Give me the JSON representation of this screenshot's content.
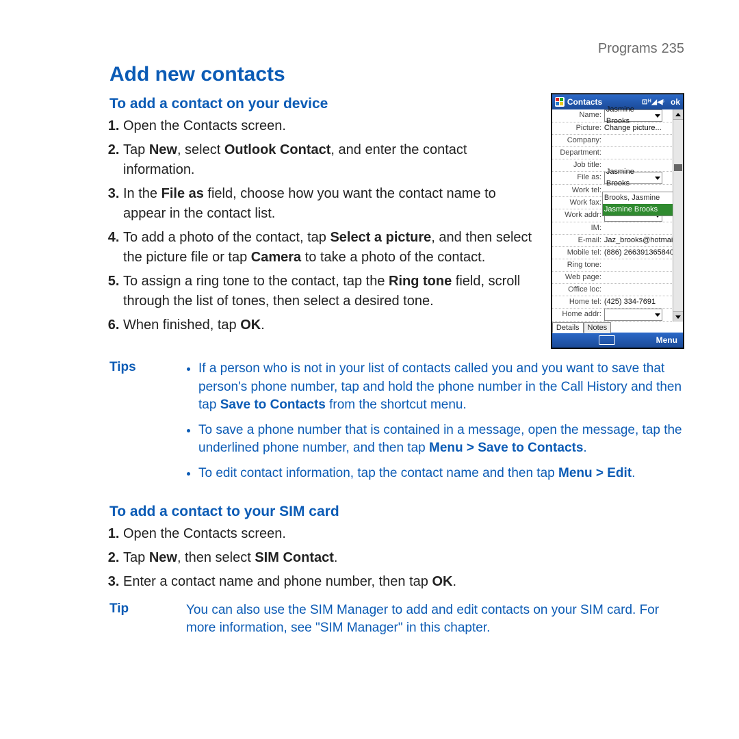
{
  "header": {
    "section": "Programs",
    "page": "235"
  },
  "h1": "Add new contacts",
  "sec1": {
    "title": "To add a contact on your device",
    "steps": {
      "s1": "Open the Contacts screen.",
      "s2a": "Tap ",
      "s2b": "New",
      "s2c": ", select ",
      "s2d": "Outlook Contact",
      "s2e": ", and enter the contact information.",
      "s3a": "In the ",
      "s3b": "File as",
      "s3c": " field, choose how you want the contact name to appear in the contact list.",
      "s4a": "To add a photo of the contact, tap ",
      "s4b": "Select a picture",
      "s4c": ", and then select the picture file or tap ",
      "s4d": "Camera",
      "s4e": " to take a photo of the contact.",
      "s5a": "To assign a ring tone to the contact, tap the ",
      "s5b": "Ring tone",
      "s5c": " field, scroll through the list of tones, then select a desired tone.",
      "s6a": "When finished, tap ",
      "s6b": "OK",
      "s6c": "."
    }
  },
  "tips": {
    "label": "Tips",
    "t1a": "If a person who is not in your list of contacts called you and you want to save that person's phone number, tap and hold the phone number in the Call History and then tap ",
    "t1b": "Save to Contacts",
    "t1c": " from the shortcut menu.",
    "t2a": "To save a phone number that is contained in a message, open the message, tap the underlined phone number, and then tap ",
    "t2b": "Menu > Save to Contacts",
    "t2c": ".",
    "t3a": "To edit contact information, tap the contact name and then tap ",
    "t3b": "Menu > Edit",
    "t3c": "."
  },
  "sec2": {
    "title": "To add a contact to your SIM card",
    "steps": {
      "s1": "Open the Contacts screen.",
      "s2a": "Tap ",
      "s2b": "New",
      "s2c": ", then select ",
      "s2d": "SIM Contact",
      "s2e": ".",
      "s3a": "Enter a contact name and phone number, then tap ",
      "s3b": "OK",
      "s3c": "."
    }
  },
  "tip2": {
    "label": "Tip",
    "body": "You can also use the SIM Manager to add and edit contacts on your SIM card. For more information, see \"SIM Manager\" in this chapter."
  },
  "phone": {
    "title": "Contacts",
    "ok": "ok",
    "sys": "⊡ ᴴ ◢ ◀ᵋ",
    "labels": {
      "name": "Name:",
      "picture": "Picture:",
      "company": "Company:",
      "department": "Department:",
      "job": "Job title:",
      "fileas": "File as:",
      "worktel": "Work tel:",
      "workfax": "Work fax:",
      "workaddr": "Work addr:",
      "im": "IM:",
      "email": "E-mail:",
      "mobile": "Mobile tel:",
      "ring": "Ring tone:",
      "web": "Web page:",
      "office": "Office loc:",
      "hometel": "Home tel:",
      "homeaddr": "Home addr:"
    },
    "values": {
      "name": "Jasmine Brooks",
      "picture": "Change picture...",
      "fileas": "Jasmine Brooks",
      "email": "Jaz_brooks@hotmail....",
      "mobile": "(886) 266391365840",
      "hometel": "(425) 334-7691"
    },
    "dropdown": {
      "opt1": "Brooks, Jasmine",
      "opt2": "Jasmine Brooks"
    },
    "tabs": {
      "details": "Details",
      "notes": "Notes"
    },
    "menu": "Menu"
  }
}
